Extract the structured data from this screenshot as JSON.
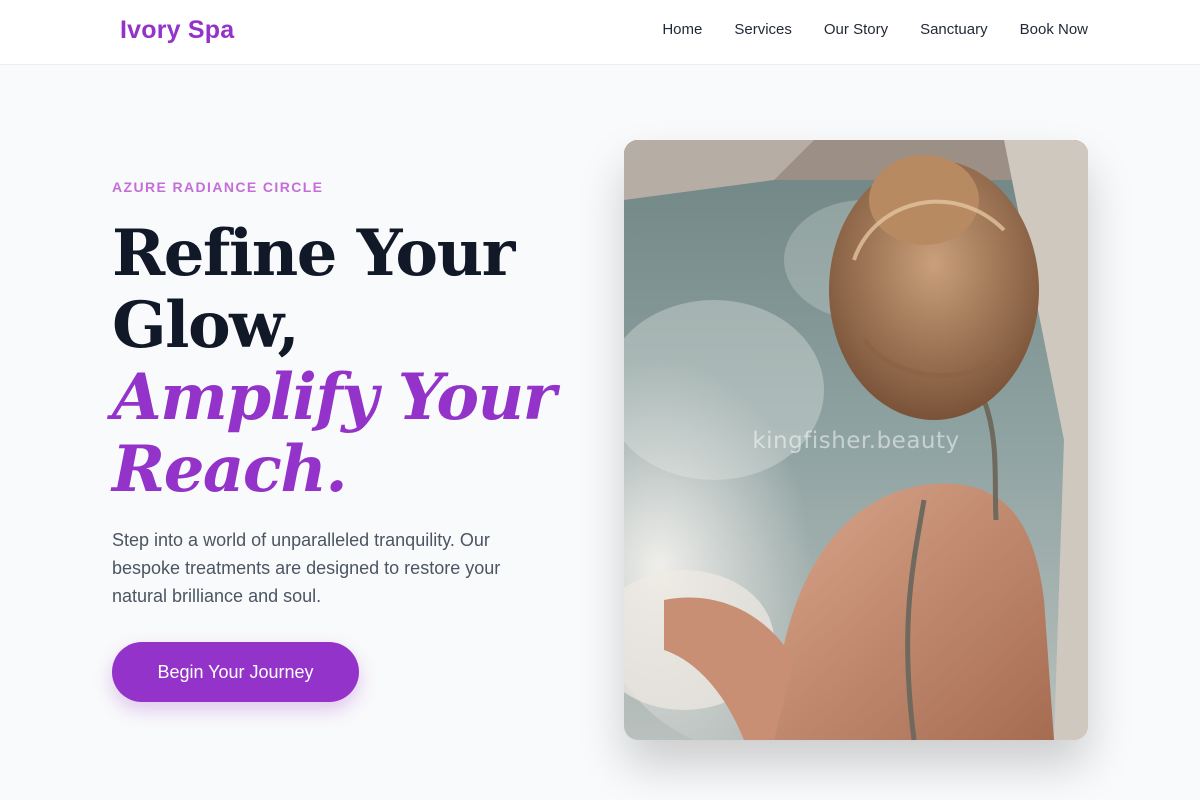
{
  "brand": {
    "name": "Ivory Spa",
    "accent_color": "#9333c9",
    "eyebrow_color": "#c46fd9"
  },
  "nav": {
    "items": [
      {
        "label": "Home"
      },
      {
        "label": "Services"
      },
      {
        "label": "Our Story"
      },
      {
        "label": "Sanctuary"
      },
      {
        "label": "Book Now"
      }
    ]
  },
  "hero": {
    "eyebrow": "AZURE RADIANCE CIRCLE",
    "headline": {
      "line1": "Refine Your",
      "line2": "Glow,",
      "line3": "Amplify Your",
      "line4": "Reach."
    },
    "lead": "Step into a world of unparalleled tranquility. Our bespoke treatments are designed to restore your natural brilliance and soul.",
    "cta_label": "Begin Your Journey",
    "image": {
      "subject": "woman relaxing in a bubbling spa pool",
      "watermark": "kingfisher.beauty"
    }
  }
}
